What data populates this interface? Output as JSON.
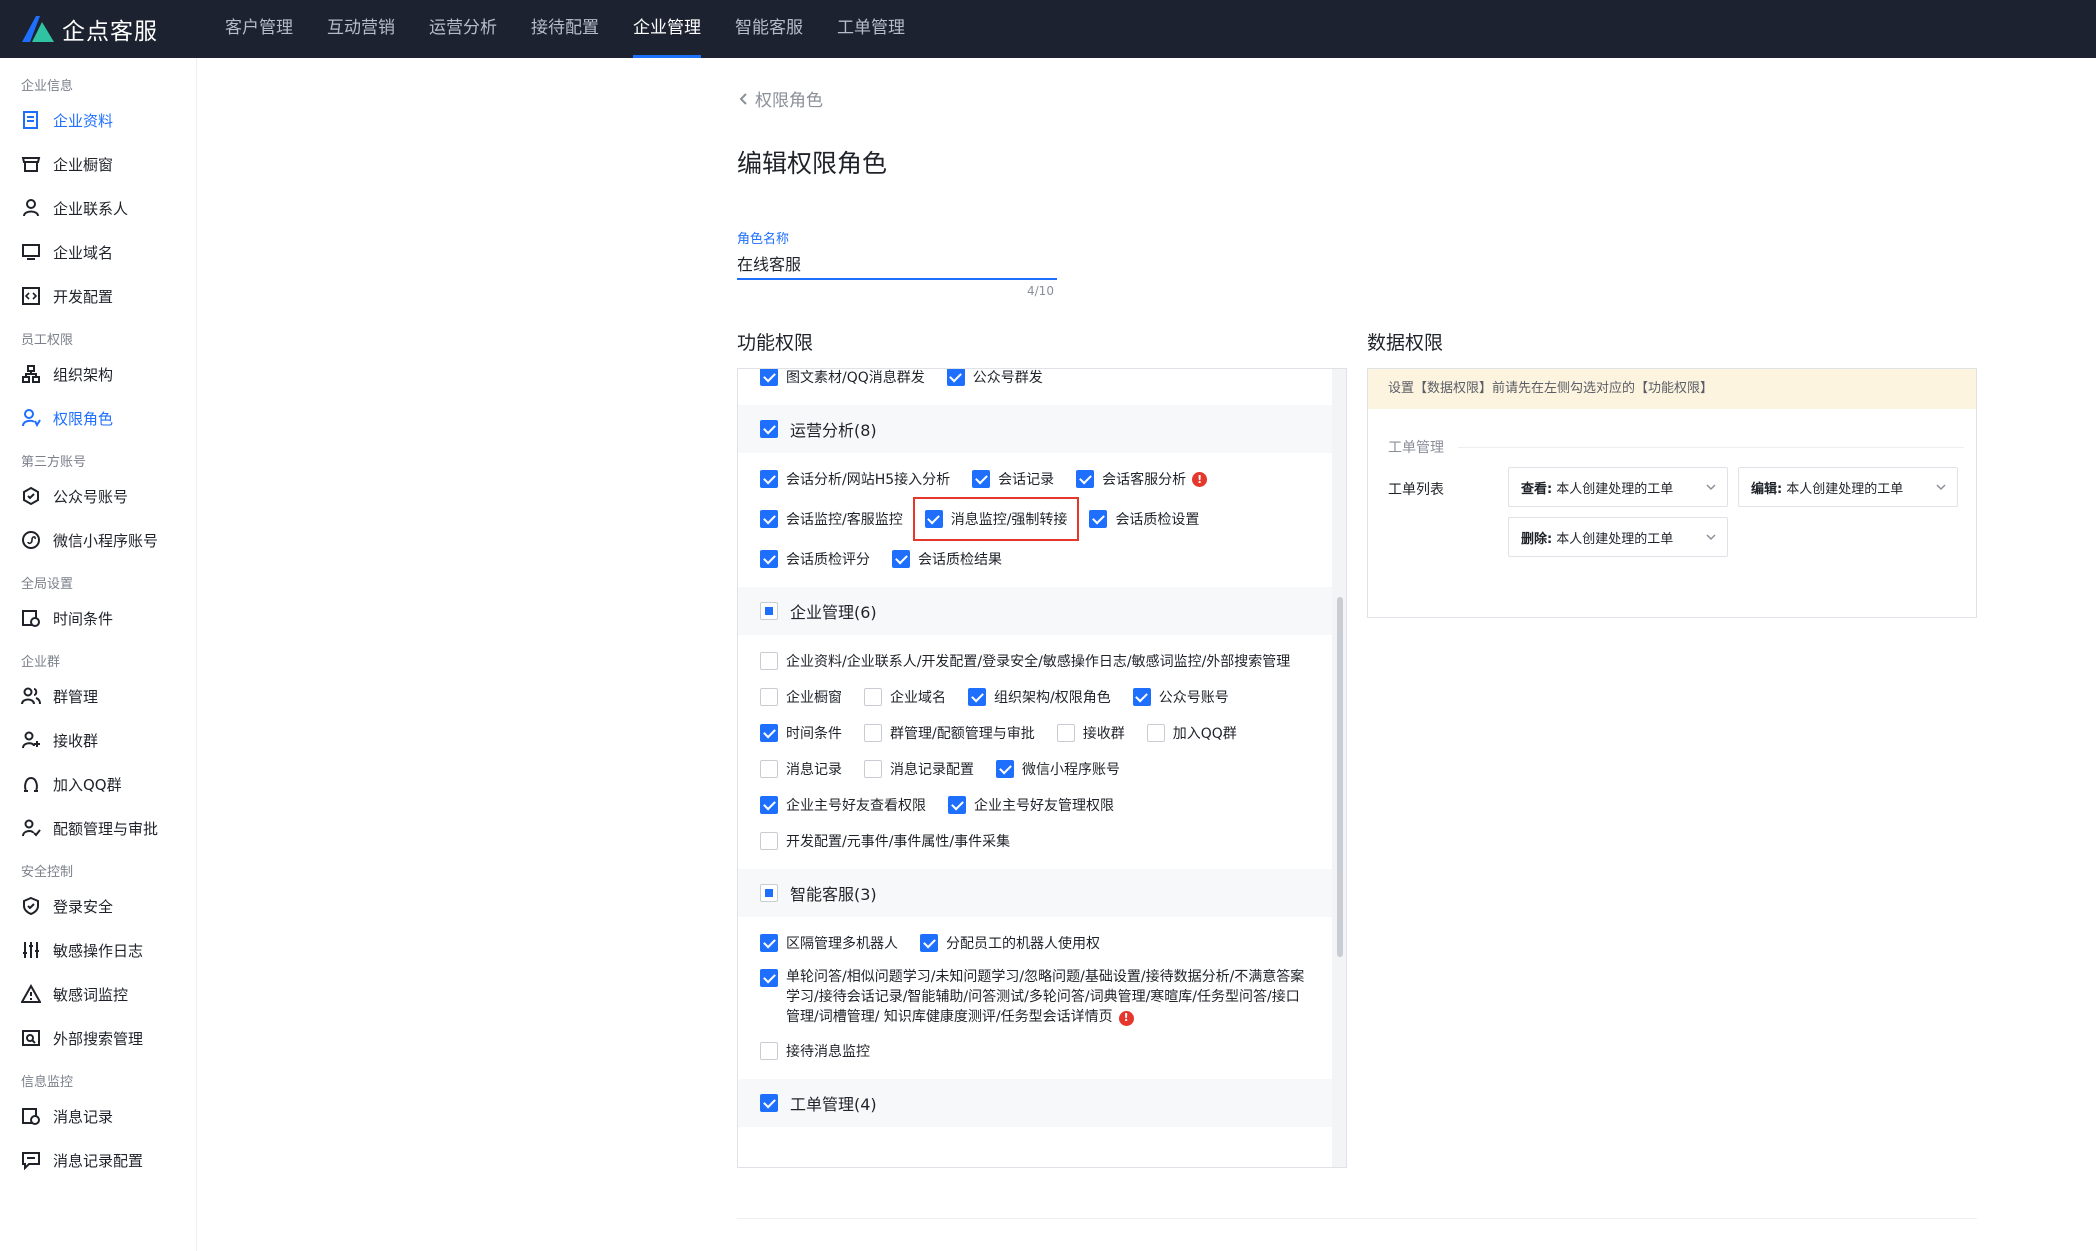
{
  "app": {
    "brand": "企点客服"
  },
  "topnav": [
    {
      "label": "客户管理",
      "active": false
    },
    {
      "label": "互动营销",
      "active": false
    },
    {
      "label": "运营分析",
      "active": false
    },
    {
      "label": "接待配置",
      "active": false
    },
    {
      "label": "企业管理",
      "active": true
    },
    {
      "label": "智能客服",
      "active": false
    },
    {
      "label": "工单管理",
      "active": false
    }
  ],
  "sidebar": {
    "g1": "企业信息",
    "g1_items": [
      "企业资料",
      "企业橱窗",
      "企业联系人",
      "企业域名",
      "开发配置"
    ],
    "g2": "员工权限",
    "g2_items": [
      "组织架构",
      "权限角色"
    ],
    "g3": "第三方账号",
    "g3_items": [
      "公众号账号",
      "微信小程序账号"
    ],
    "g4": "全局设置",
    "g4_items": [
      "时间条件"
    ],
    "g5": "企业群",
    "g5_items": [
      "群管理",
      "接收群",
      "加入QQ群",
      "配额管理与审批"
    ],
    "g6": "安全控制",
    "g6_items": [
      "登录安全",
      "敏感操作日志",
      "敏感词监控",
      "外部搜索管理"
    ],
    "g7": "信息监控",
    "g7_items": [
      "消息记录",
      "消息记录配置"
    ]
  },
  "main": {
    "back": "权限角色",
    "title": "编辑权限角色",
    "name_label": "角色名称",
    "name_value": "在线客服",
    "counter": "4/10",
    "func_title": "功能权限",
    "data_title": "数据权限"
  },
  "func": {
    "top_row": [
      {
        "label": "图文素材/QQ消息群发",
        "on": true
      },
      {
        "label": "公众号群发",
        "on": true
      }
    ],
    "ops": {
      "header": "运营分析(8)",
      "r1": [
        {
          "label": "会话分析/网站H5接入分析",
          "on": true
        },
        {
          "label": "会话记录",
          "on": true
        },
        {
          "label": "会话客服分析",
          "on": true
        }
      ],
      "r2a": {
        "label": "会话监控/客服监控",
        "on": true
      },
      "r2b": {
        "label": "消息监控/强制转接",
        "on": true
      },
      "r2c": {
        "label": "会话质检设置",
        "on": true
      },
      "r3": [
        {
          "label": "会话质检评分",
          "on": true
        },
        {
          "label": "会话质检结果",
          "on": true
        }
      ]
    },
    "ent": {
      "header": "企业管理(6)",
      "r1": [
        {
          "label": "企业资料/企业联系人/开发配置/登录安全/敏感操作日志/敏感词监控/外部搜索管理",
          "on": false
        }
      ],
      "r2": [
        {
          "label": "企业橱窗",
          "on": false
        },
        {
          "label": "企业域名",
          "on": false
        },
        {
          "label": "组织架构/权限角色",
          "on": true
        },
        {
          "label": "公众号账号",
          "on": true
        }
      ],
      "r3": [
        {
          "label": "时间条件",
          "on": true
        },
        {
          "label": "群管理/配额管理与审批",
          "on": false
        },
        {
          "label": "接收群",
          "on": false
        },
        {
          "label": "加入QQ群",
          "on": false
        }
      ],
      "r4": [
        {
          "label": "消息记录",
          "on": false
        },
        {
          "label": "消息记录配置",
          "on": false
        },
        {
          "label": "微信小程序账号",
          "on": true
        }
      ],
      "r5": [
        {
          "label": "企业主号好友查看权限",
          "on": true
        },
        {
          "label": "企业主号好友管理权限",
          "on": true
        }
      ],
      "r6": [
        {
          "label": "开发配置/元事件/事件属性/事件采集",
          "on": false
        }
      ]
    },
    "ai": {
      "header": "智能客服(3)",
      "r1": [
        {
          "label": "区隔管理多机器人",
          "on": true
        },
        {
          "label": "分配员工的机器人使用权",
          "on": true
        }
      ],
      "multi": "单轮问答/相似问题学习/未知问题学习/忽略问题/基础设置/接待数据分析/不满意答案学习/接待会话记录/智能辅助/问答测试/多轮问答/词典管理/寒暄库/任务型问答/接口管理/词槽管理/ 知识库健康度测评/任务型会话详情页",
      "r3": [
        {
          "label": "接待消息监控",
          "on": false
        }
      ]
    },
    "wo": {
      "header": "工单管理(4)"
    }
  },
  "data": {
    "notice": "设置【数据权限】前请先在左侧勾选对应的【功能权限】",
    "section": "工单管理",
    "label": "工单列表",
    "sel1_k": "查看:",
    "sel1_v": "本人创建处理的工单",
    "sel2_k": "编辑:",
    "sel2_v": "本人创建处理的工单",
    "sel3_k": "删除:",
    "sel3_v": "本人创建处理的工单"
  },
  "colors": {
    "accent": "#1f6fff",
    "topbar": "#1c2230",
    "warn": "#e5372c"
  }
}
